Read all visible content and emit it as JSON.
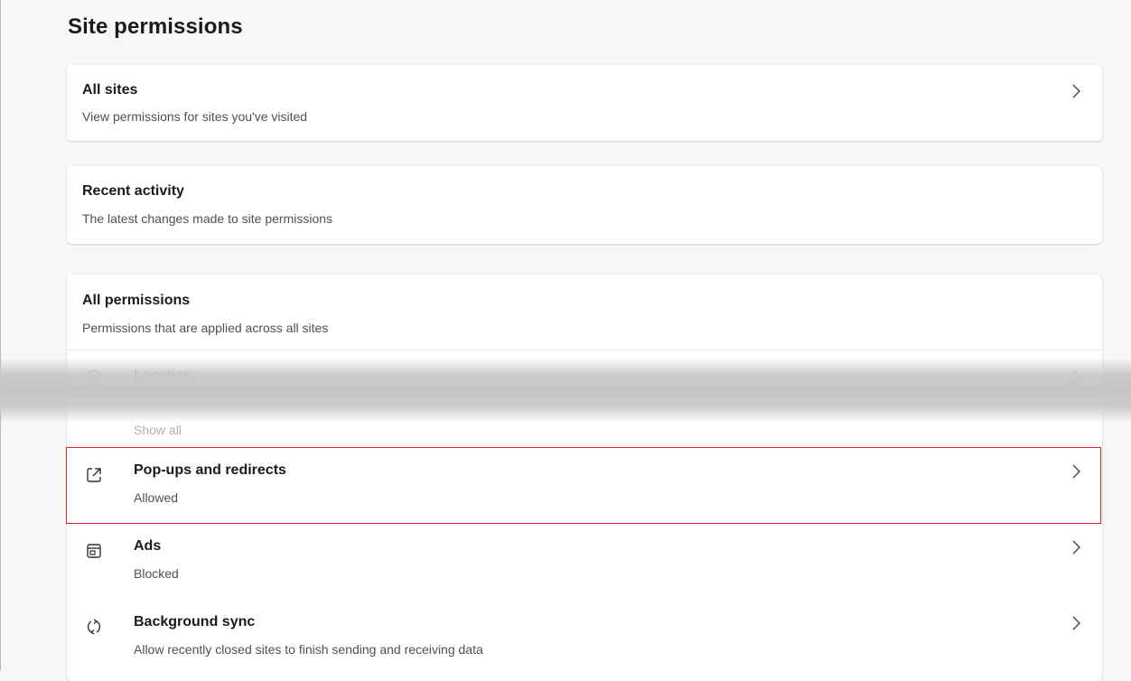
{
  "page": {
    "title": "Site permissions"
  },
  "all_sites": {
    "title": "All sites",
    "subtitle": "View permissions for sites you've visited"
  },
  "recent_activity": {
    "title": "Recent activity",
    "subtitle": "The latest changes made to site permissions"
  },
  "all_permissions": {
    "title": "All permissions",
    "subtitle": "Permissions that are applied across all sites",
    "items": [
      {
        "label": "Location",
        "status": "Show all",
        "icon": "location-icon"
      },
      {
        "label": "Pop-ups and redirects",
        "status": "Allowed",
        "icon": "popup-icon"
      },
      {
        "label": "Ads",
        "status": "Blocked",
        "icon": "ads-icon"
      },
      {
        "label": "Background sync",
        "status": "Allow recently closed sites to finish sending and receiving data",
        "icon": "sync-icon"
      }
    ]
  },
  "colors": {
    "highlight_border": "#e0202c",
    "card_bg": "#ffffff",
    "page_bg": "#f7f7f7"
  }
}
